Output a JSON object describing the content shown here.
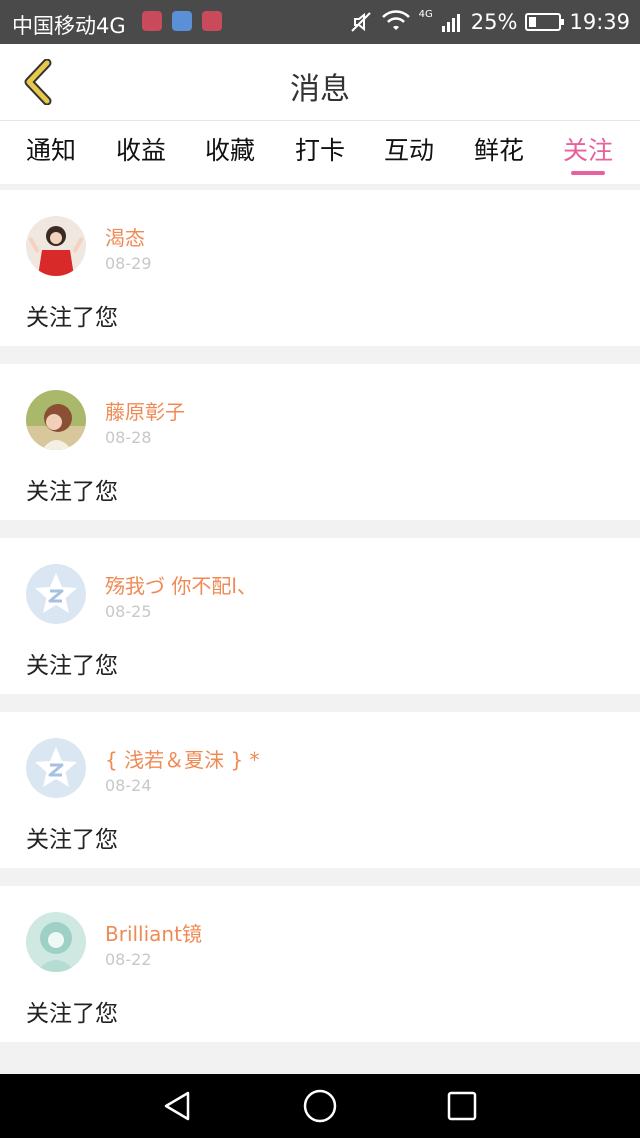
{
  "status_bar": {
    "carrier": "中国移动4G",
    "network_label": "4G",
    "battery_percent": "25%",
    "battery_level": 0.25,
    "time": "19:39"
  },
  "header": {
    "title": "消息",
    "back_icon": "chevron-left-icon"
  },
  "tabs": [
    {
      "label": "通知"
    },
    {
      "label": "收益"
    },
    {
      "label": "收藏"
    },
    {
      "label": "打卡"
    },
    {
      "label": "互动"
    },
    {
      "label": "鲜花"
    },
    {
      "label": "关注",
      "active": true
    }
  ],
  "notifications": [
    {
      "user": "渴态",
      "date": "08-29",
      "message": "关注了您",
      "avatar": "photo-girl-red-shirt"
    },
    {
      "user": "藤原彰子",
      "date": "08-28",
      "message": "关注了您",
      "avatar": "photo-girl-outdoor"
    },
    {
      "user": "殇我づ 你不配l、",
      "date": "08-25",
      "message": "关注了您",
      "avatar": "default-star-avatar"
    },
    {
      "user": "{ 浅若＆夏沫 } *",
      "date": "08-24",
      "message": "关注了您",
      "avatar": "default-star-avatar"
    },
    {
      "user": "Brilliant镜",
      "date": "08-22",
      "message": "关注了您",
      "avatar": "photo-illustration-teal"
    }
  ],
  "colors": {
    "accent": "#e8619c",
    "username": "#f08a55",
    "back_icon": "#e7c84a",
    "status_bar": "#4a4a4a"
  }
}
